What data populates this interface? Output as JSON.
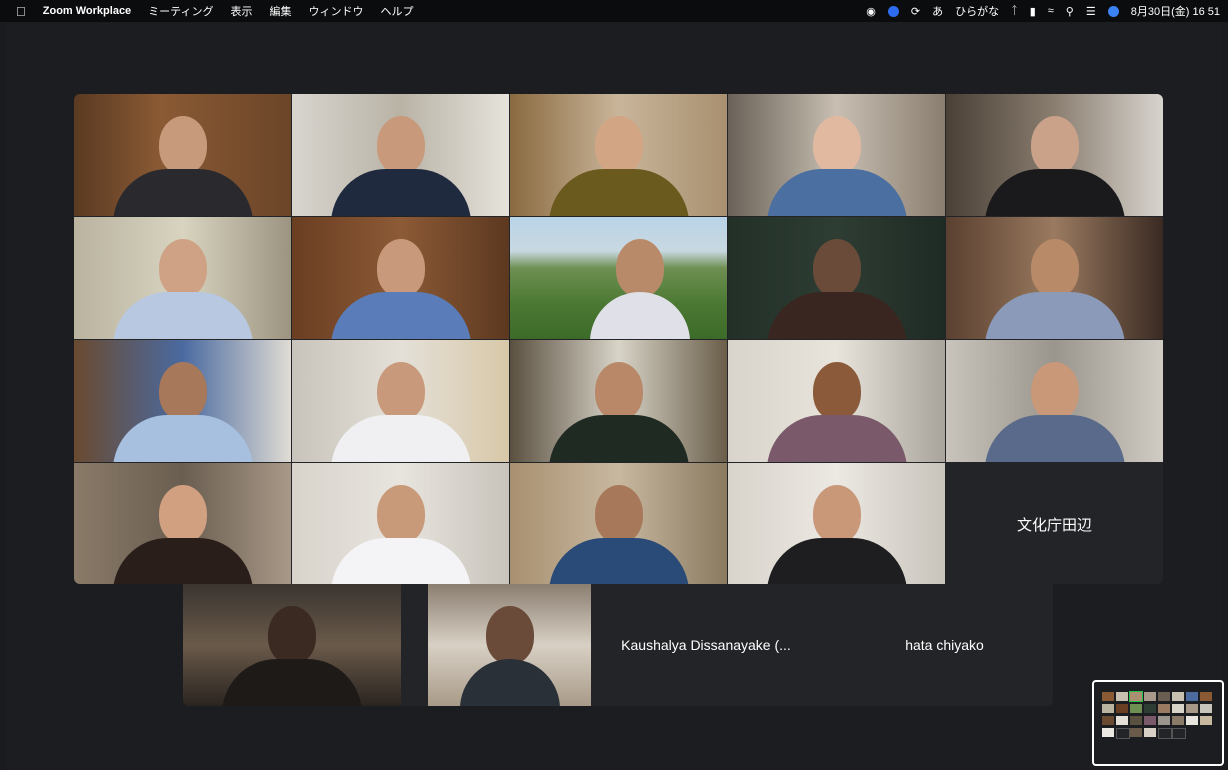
{
  "menubar": {
    "apple": "",
    "app_name": "Zoom Workplace",
    "menus": [
      "ミーティング",
      "表示",
      "編集",
      "ウィンドウ",
      "ヘルプ"
    ],
    "ime": "ひらがな",
    "datetime": "8月30日(金) 16 51"
  },
  "gallery": {
    "name_tiles": {
      "bunka": "文化庁田辺",
      "kaushalya": "Kaushalya Dissanayake (...",
      "hata": "hata chiyako"
    }
  },
  "colors": {
    "active_speaker": "#27c24a",
    "background": "#1c1d20",
    "tile_background": "#232427"
  }
}
